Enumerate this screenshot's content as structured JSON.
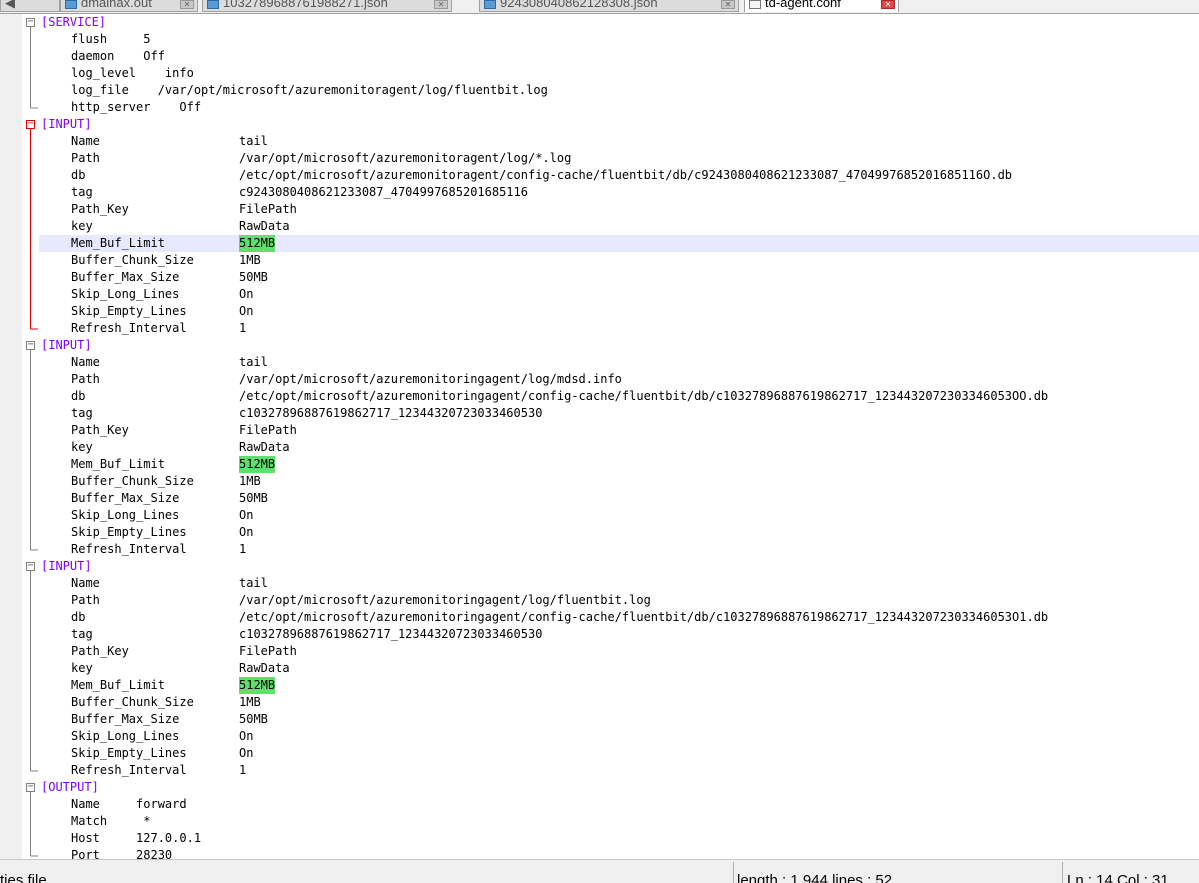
{
  "tabs": [
    {
      "label": "dmainax.out",
      "active": false
    },
    {
      "label": "1032789688761988271.json",
      "active": false
    },
    {
      "label": "924308040862128308.json",
      "active": false
    },
    {
      "label": "td-agent.conf",
      "active": true
    }
  ],
  "editor": {
    "caret_line": 13,
    "lines": [
      {
        "text": "[SERVICE]",
        "section": true
      },
      {
        "text": "flush     5"
      },
      {
        "text": "daemon    Off"
      },
      {
        "text": "log_level    info"
      },
      {
        "text": "log_file    /var/opt/microsoft/azuremonitoragent/log/fluentbit.log"
      },
      {
        "text": "http_server    Off"
      },
      {
        "text": "[INPUT]",
        "section": true
      },
      {
        "key": "Name",
        "value": "tail"
      },
      {
        "key": "Path",
        "value": "/var/opt/microsoft/azuremonitoragent/log/*.log"
      },
      {
        "key": "db",
        "value": "/etc/opt/microsoft/azuremonitoragent/config-cache/fluentbit/db/c9243080408621233087_4704997685201685116O.db"
      },
      {
        "key": "tag",
        "value": "c9243080408621233087_4704997685201685116"
      },
      {
        "key": "Path_Key",
        "value": "FilePath"
      },
      {
        "key": "key",
        "value": "RawData"
      },
      {
        "key": "Mem_Buf_Limit",
        "value": "512MB",
        "highlight": true
      },
      {
        "key": "Buffer_Chunk_Size",
        "value": "1MB"
      },
      {
        "key": "Buffer_Max_Size",
        "value": "50MB"
      },
      {
        "key": "Skip_Long_Lines",
        "value": "On"
      },
      {
        "key": "Skip_Empty_Lines",
        "value": "On"
      },
      {
        "key": "Refresh_Interval",
        "value": "1"
      },
      {
        "text": "[INPUT]",
        "section": true
      },
      {
        "key": "Name",
        "value": "tail"
      },
      {
        "key": "Path",
        "value": "/var/opt/microsoft/azuremonitoringagent/log/mdsd.info"
      },
      {
        "key": "db",
        "value": "/etc/opt/microsoft/azuremonitoringagent/config-cache/fluentbit/db/c10327896887619862717_1234432072303346053OO.db"
      },
      {
        "key": "tag",
        "value": "c10327896887619862717_12344320723033460530"
      },
      {
        "key": "Path_Key",
        "value": "FilePath"
      },
      {
        "key": "key",
        "value": "RawData"
      },
      {
        "key": "Mem_Buf_Limit",
        "value": "512MB",
        "highlight": true
      },
      {
        "key": "Buffer_Chunk_Size",
        "value": "1MB"
      },
      {
        "key": "Buffer_Max_Size",
        "value": "50MB"
      },
      {
        "key": "Skip_Long_Lines",
        "value": "On"
      },
      {
        "key": "Skip_Empty_Lines",
        "value": "On"
      },
      {
        "key": "Refresh_Interval",
        "value": "1"
      },
      {
        "text": "[INPUT]",
        "section": true
      },
      {
        "key": "Name",
        "value": "tail"
      },
      {
        "key": "Path",
        "value": "/var/opt/microsoft/azuremonitoringagent/log/fluentbit.log"
      },
      {
        "key": "db",
        "value": "/etc/opt/microsoft/azuremonitoringagent/config-cache/fluentbit/db/c10327896887619862717_1234432072303346053O1.db"
      },
      {
        "key": "tag",
        "value": "c10327896887619862717_12344320723033460530"
      },
      {
        "key": "Path_Key",
        "value": "FilePath"
      },
      {
        "key": "key",
        "value": "RawData"
      },
      {
        "key": "Mem_Buf_Limit",
        "value": "512MB",
        "highlight": true
      },
      {
        "key": "Buffer_Chunk_Size",
        "value": "1MB"
      },
      {
        "key": "Buffer_Max_Size",
        "value": "50MB"
      },
      {
        "key": "Skip_Long_Lines",
        "value": "On"
      },
      {
        "key": "Skip_Empty_Lines",
        "value": "On"
      },
      {
        "key": "Refresh_Interval",
        "value": "1"
      },
      {
        "text": "[OUTPUT]",
        "section": true
      },
      {
        "text": "Name     forward"
      },
      {
        "text": "Match     *"
      },
      {
        "text": "Host     127.0.0.1"
      },
      {
        "text": "Port     28230"
      }
    ]
  },
  "status": {
    "file_type": "ties file",
    "length_lines": "length : 1,944    lines : 52",
    "position": "Ln : 14    Col : 31"
  },
  "colors": {
    "section_header": "#8000ff",
    "highlight": "#5fe06a",
    "caret_line": "#e8e8ff",
    "fold_open": "#e00000"
  }
}
